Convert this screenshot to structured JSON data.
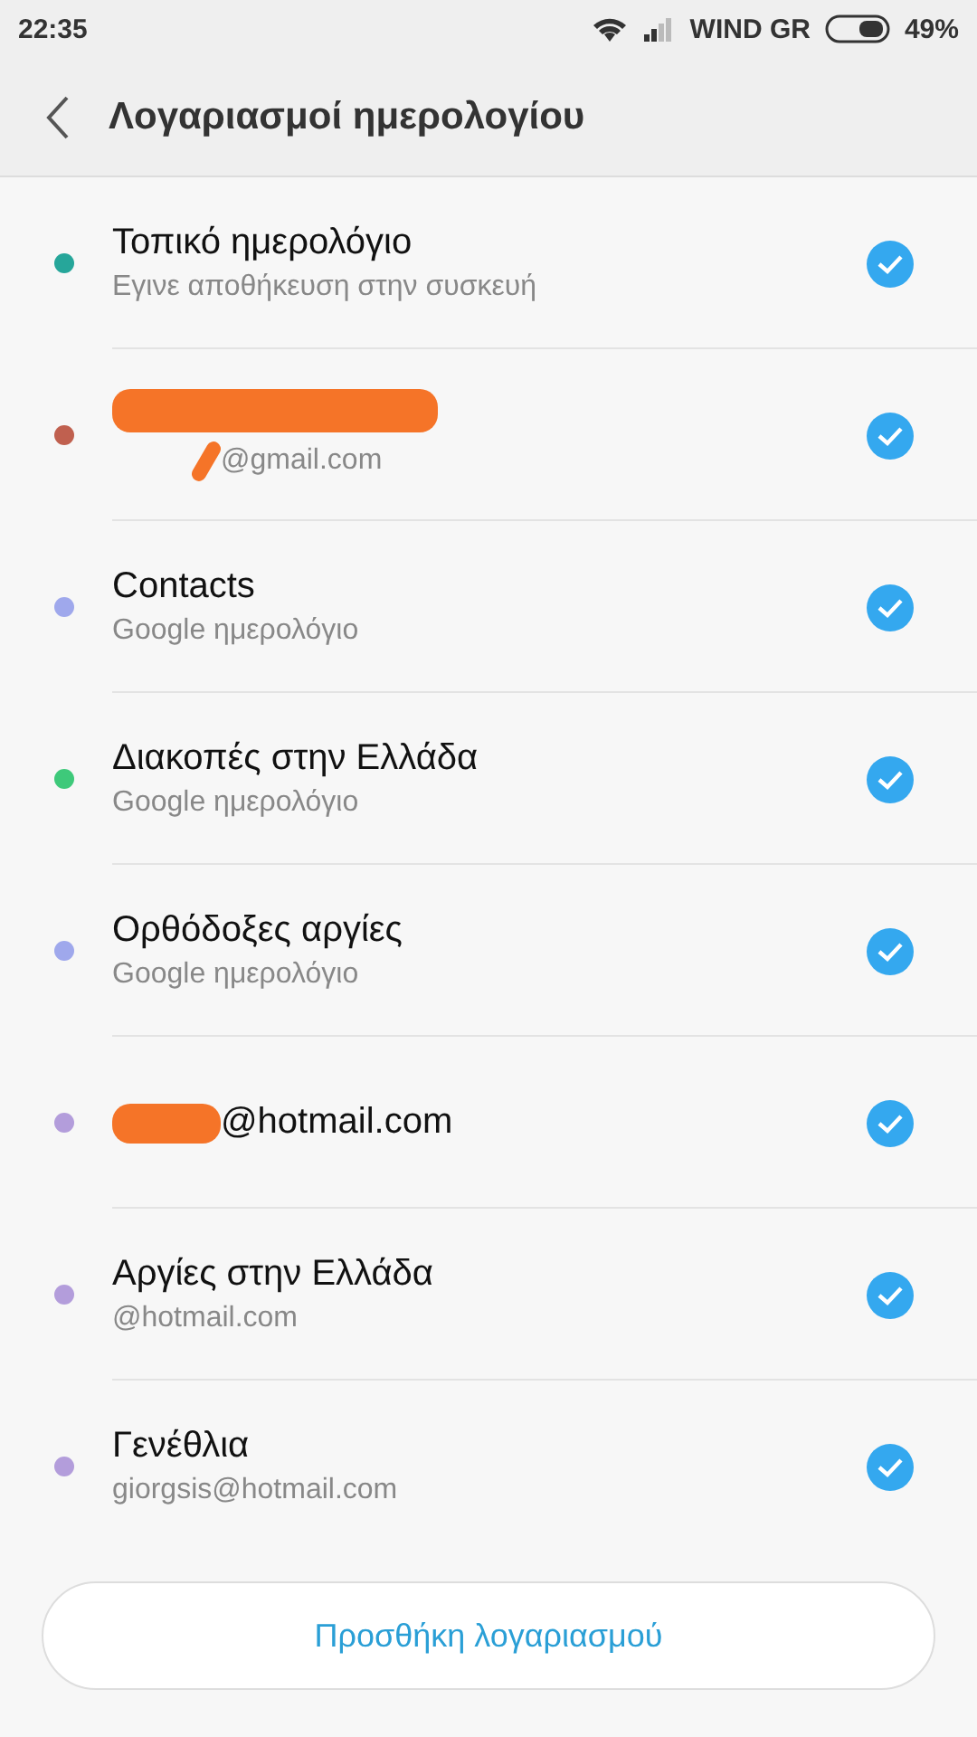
{
  "status_bar": {
    "time": "22:35",
    "carrier": "WIND GR",
    "battery": "49%"
  },
  "header": {
    "title": "Λογαριασμοί ημερολογίου"
  },
  "calendars": [
    {
      "title": "Τοπικό ημερολόγιο",
      "subtitle": "Εγινε αποθήκευση στην συσκευή",
      "color": "#26a69a",
      "checked": true
    },
    {
      "title_redacted": true,
      "subtitle": "@gmail.com",
      "subtitle_redacted": true,
      "color": "#c0604f",
      "checked": true
    },
    {
      "title": "Contacts",
      "subtitle": "Google ημερολόγιο",
      "color": "#9fa8ec",
      "checked": true
    },
    {
      "title": "Διακοπές στην Ελλάδα",
      "subtitle": "Google ημερολόγιο",
      "color": "#3ec97a",
      "checked": true
    },
    {
      "title": "Ορθόδοξες αργίες",
      "subtitle": "Google ημερολόγιο",
      "color": "#9fa8ec",
      "checked": true
    },
    {
      "title": "@hotmail.com",
      "title_redacted": true,
      "color": "#b39ddb",
      "checked": true
    },
    {
      "title": "Αργίες στην Ελλάδα",
      "subtitle": "@hotmail.com",
      "color": "#b39ddb",
      "checked": true
    },
    {
      "title": "Γενέθλια",
      "subtitle": "giorgsis@hotmail.com",
      "color": "#b39ddb",
      "checked": true
    }
  ],
  "add_button": {
    "label": "Προσθήκη λογαριασμού"
  }
}
